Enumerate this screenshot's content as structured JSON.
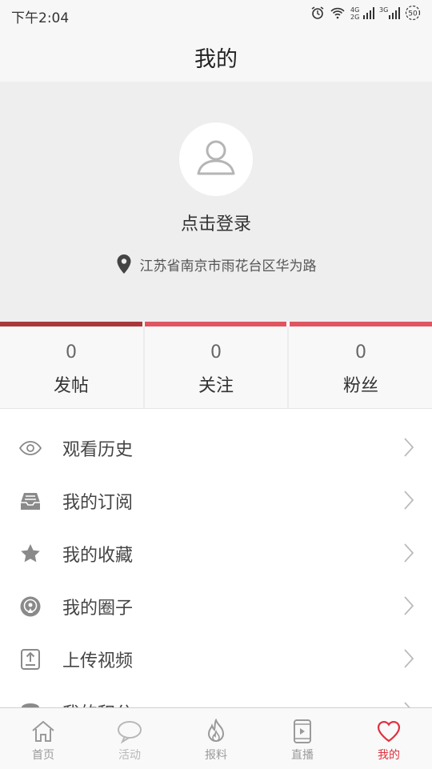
{
  "status_bar": {
    "time": "下午2:04",
    "network_1": "4G",
    "network_2": "2G",
    "network_3": "3G",
    "battery": "50"
  },
  "header": {
    "title": "我的"
  },
  "profile": {
    "avatar_icon": "user-avatar-icon",
    "login_text": "点击登录",
    "location_icon": "location-pin-icon",
    "location": "江苏省南京市雨花台区华为路"
  },
  "stats": [
    {
      "value": "0",
      "label": "发帖"
    },
    {
      "value": "0",
      "label": "关注"
    },
    {
      "value": "0",
      "label": "粉丝"
    }
  ],
  "menu": [
    {
      "label": "观看历史",
      "icon": "eye-icon"
    },
    {
      "label": "我的订阅",
      "icon": "inbox-icon"
    },
    {
      "label": "我的收藏",
      "icon": "star-icon"
    },
    {
      "label": "我的圈子",
      "icon": "circle-broadcast-icon"
    },
    {
      "label": "上传视频",
      "icon": "upload-icon"
    },
    {
      "label": "我的积分",
      "icon": "coins-icon"
    }
  ],
  "bottom_nav": [
    {
      "label": "首页",
      "icon": "home-icon"
    },
    {
      "label": "活动",
      "icon": "chat-bubble-icon"
    },
    {
      "label": "报料",
      "icon": "flame-icon"
    },
    {
      "label": "直播",
      "icon": "phone-play-icon"
    },
    {
      "label": "我的",
      "icon": "heart-icon",
      "active": true
    }
  ],
  "colors": {
    "accent": "#e0313e",
    "stat_bar_dark": "#a8383a",
    "stat_bar_light": "#e05560",
    "profile_bg": "#efeeee"
  }
}
